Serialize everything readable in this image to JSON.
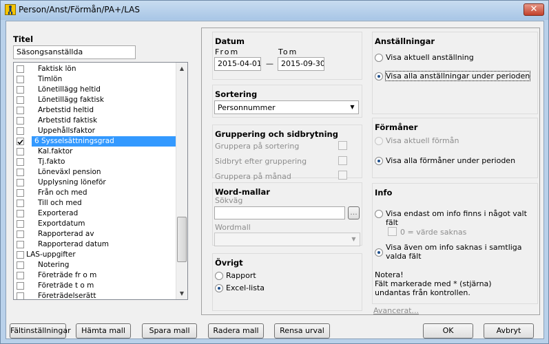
{
  "window": {
    "title": "Person/Anst/Förmån/PA+/LAS",
    "close_glyph": "✕"
  },
  "titel": {
    "label": "Titel",
    "value": "Säsongsanställda"
  },
  "fieldlist": {
    "items": [
      {
        "label": "Faktisk lön",
        "checked": false,
        "indent": true
      },
      {
        "label": "Timlön",
        "checked": false,
        "indent": true
      },
      {
        "label": "Lönetillägg heltid",
        "checked": false,
        "indent": true
      },
      {
        "label": "Lönetillägg faktisk",
        "checked": false,
        "indent": true
      },
      {
        "label": "Arbetstid heltid",
        "checked": false,
        "indent": true
      },
      {
        "label": "Arbetstid faktisk",
        "checked": false,
        "indent": true
      },
      {
        "label": "Uppehållsfaktor",
        "checked": false,
        "indent": true
      },
      {
        "label": "6 Sysselsättningsgrad",
        "checked": true,
        "indent": true,
        "selected": true
      },
      {
        "label": "Kal.faktor",
        "checked": false,
        "indent": true
      },
      {
        "label": "Tj.fakto",
        "checked": false,
        "indent": true
      },
      {
        "label": "Löneväxl pension",
        "checked": false,
        "indent": true
      },
      {
        "label": "Upplysning löneför",
        "checked": false,
        "indent": true
      },
      {
        "label": "Från och med",
        "checked": false,
        "indent": true
      },
      {
        "label": "Till och med",
        "checked": false,
        "indent": true
      },
      {
        "label": "Exporterad",
        "checked": false,
        "indent": true
      },
      {
        "label": "Exportdatum",
        "checked": false,
        "indent": true
      },
      {
        "label": "Rapporterad av",
        "checked": false,
        "indent": true
      },
      {
        "label": "Rapporterad datum",
        "checked": false,
        "indent": true
      },
      {
        "label": "LAS-uppgifter",
        "checked": false,
        "indent": false
      },
      {
        "label": "Notering",
        "checked": false,
        "indent": true
      },
      {
        "label": "Företräde fr o m",
        "checked": false,
        "indent": true
      },
      {
        "label": "Företräde t o m",
        "checked": false,
        "indent": true
      },
      {
        "label": "Företrädelserätt",
        "checked": false,
        "indent": true
      }
    ]
  },
  "datum": {
    "title": "Datum",
    "from_label": "From",
    "to_label": "Tom",
    "from_value": "2015-04-01",
    "to_value": "2015-09-30",
    "dash": "—"
  },
  "sortering": {
    "title": "Sortering",
    "selected": "Personnummer"
  },
  "gruppering": {
    "title": "Gruppering och sidbrytning",
    "options": [
      "Gruppera på sortering",
      "Sidbryt efter gruppering",
      "Gruppera på månad"
    ]
  },
  "word": {
    "title": "Word-mallar",
    "path_label": "Sökväg",
    "path_value": "",
    "browse": "...",
    "template_label": "Wordmall",
    "template_value": ""
  },
  "ovrigt": {
    "title": "Övrigt",
    "options": [
      "Rapport",
      "Excel-lista"
    ],
    "selected": 1
  },
  "anstallningar": {
    "title": "Anställningar",
    "options": [
      "Visa aktuell anställning",
      "Visa alla anställningar under perioden"
    ],
    "selected": 1
  },
  "formaner": {
    "title": "Förmåner",
    "options": [
      "Visa aktuell förmån",
      "Visa alla förmåner under perioden"
    ],
    "selected": 1
  },
  "info": {
    "title": "Info",
    "option1": "Visa endast om info finns i något valt fält",
    "sub_checkbox": "0 = värde saknas",
    "option2_line1": "Visa även om info saknas i samtliga",
    "option2_line2": "valda fält",
    "selected": 2,
    "note_line1": "Notera!",
    "note_line2": "Fält markerade med * (stjärna)",
    "note_line3": "undantas från kontrollen."
  },
  "advanced_link": "Avancerat...",
  "buttons": {
    "field_settings": "Fältinställningar",
    "load_template": "Hämta mall",
    "save_template": "Spara mall",
    "delete_template": "Radera mall",
    "clear_selection": "Rensa urval",
    "ok": "OK",
    "cancel": "Avbryt"
  }
}
